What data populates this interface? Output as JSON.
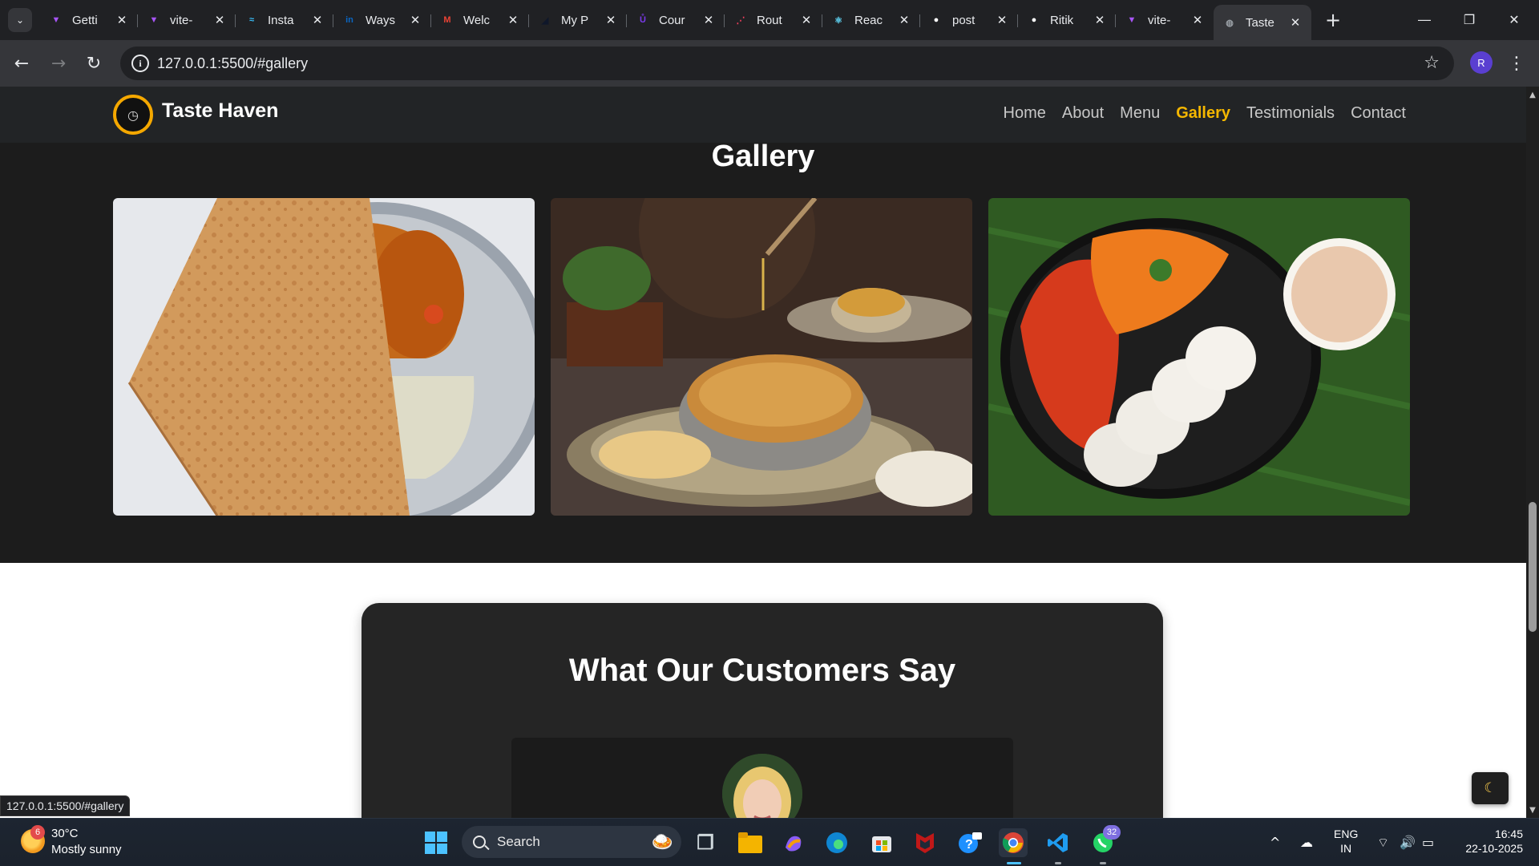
{
  "browser": {
    "tabs": [
      {
        "title": "Getti",
        "favicon": "vite-icon",
        "color": "#a855f7"
      },
      {
        "title": "vite-",
        "favicon": "vite-icon",
        "color": "#a855f7"
      },
      {
        "title": "Insta",
        "favicon": "tailwind-icon",
        "color": "#38bdf8"
      },
      {
        "title": "Ways",
        "favicon": "linkedin-icon",
        "color": "#0a66c2"
      },
      {
        "title": "Welc",
        "favicon": "gmail-icon",
        "color": "#ea4335"
      },
      {
        "title": "My P",
        "favicon": "portfolio-icon",
        "color": "#0f172a"
      },
      {
        "title": "Cour",
        "favicon": "course-icon",
        "color": "#7c3aed"
      },
      {
        "title": "Rout",
        "favicon": "router-icon",
        "color": "#f43f5e"
      },
      {
        "title": "Reac",
        "favicon": "react-icon",
        "color": "#61dafb"
      },
      {
        "title": "post",
        "favicon": "github-icon",
        "color": "#ffffff"
      },
      {
        "title": "Ritik",
        "favicon": "github-icon",
        "color": "#ffffff"
      },
      {
        "title": "vite-",
        "favicon": "vite-icon",
        "color": "#a855f7"
      },
      {
        "title": "Taste",
        "favicon": "globe-icon",
        "color": "#9aa0a6",
        "active": true
      }
    ],
    "url": "127.0.0.1:5500/#gallery",
    "profile_initial": "R",
    "status_url": "127.0.0.1:5500/#gallery"
  },
  "site": {
    "brand": "Taste Haven",
    "nav": [
      "Home",
      "About",
      "Menu",
      "Gallery",
      "Testimonials",
      "Contact"
    ],
    "active_nav": "Gallery",
    "accent_color": "#f5b700",
    "gallery_title": "Gallery",
    "gallery_images": [
      "dosa-with-chutney",
      "biryani-platter",
      "idli-with-chutney-and-coffee"
    ],
    "testimonials_title": "What Our Customers Say",
    "theme_toggle_icon": "moon-icon"
  },
  "taskbar": {
    "weather_temp": "30°C",
    "weather_desc": "Mostly sunny",
    "weather_badge": "6",
    "search_label": "Search",
    "whatsapp_badge": "32",
    "lang_top": "ENG",
    "lang_bottom": "IN",
    "time": "16:45",
    "date": "22-10-2025"
  }
}
